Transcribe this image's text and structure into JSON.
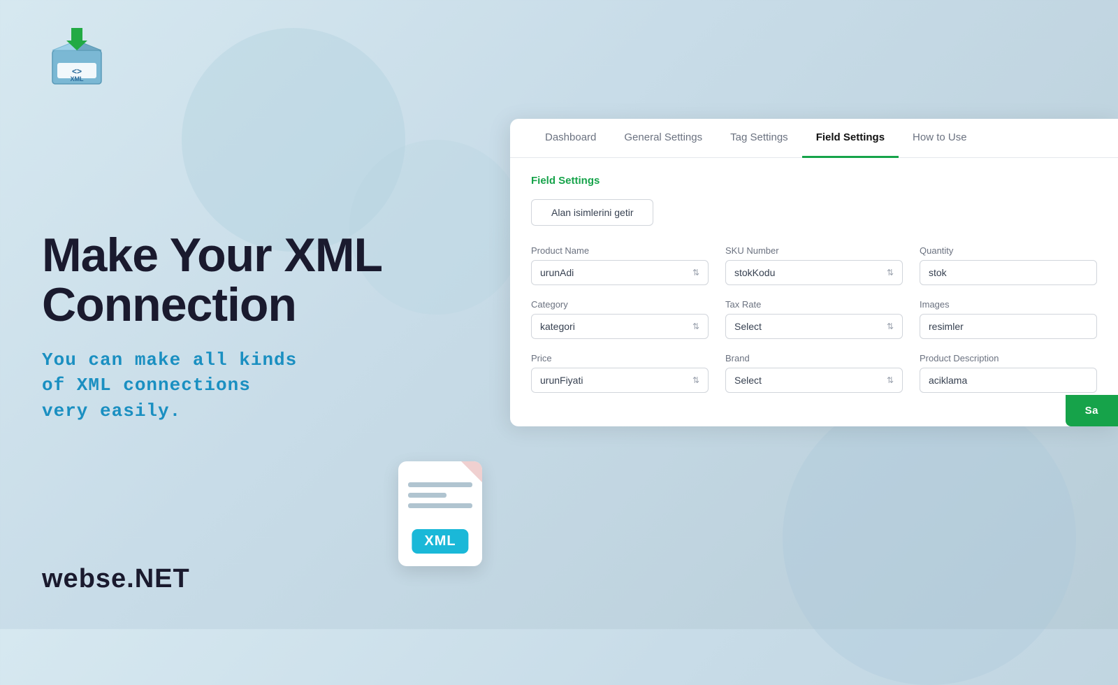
{
  "logo": {
    "alt": "XML Logo"
  },
  "hero": {
    "title": "Make Your XML Connection",
    "subtitle": "You can make all kinds\nof XML connections\nvery easily."
  },
  "brand": "webse.NET",
  "xml_file": {
    "label": "XML"
  },
  "nav": {
    "tabs": [
      {
        "id": "dashboard",
        "label": "Dashboard",
        "active": false
      },
      {
        "id": "general-settings",
        "label": "General Settings",
        "active": false
      },
      {
        "id": "tag-settings",
        "label": "Tag Settings",
        "active": false
      },
      {
        "id": "field-settings",
        "label": "Field Settings",
        "active": true
      },
      {
        "id": "how-to-use",
        "label": "How to Use",
        "active": false
      }
    ]
  },
  "field_settings": {
    "title": "Field Settings",
    "fetch_button": "Alan isimlerini getir",
    "fields": [
      {
        "id": "product-name",
        "label": "Product Name",
        "type": "select",
        "value": "urunAdi"
      },
      {
        "id": "sku-number",
        "label": "SKU Number",
        "type": "select",
        "value": "stokKodu"
      },
      {
        "id": "quantity",
        "label": "Quantity",
        "type": "input",
        "value": "stok"
      },
      {
        "id": "category",
        "label": "Category",
        "type": "select",
        "value": "kategori"
      },
      {
        "id": "tax-rate",
        "label": "Tax Rate",
        "type": "select",
        "value": "Select"
      },
      {
        "id": "images",
        "label": "Images",
        "type": "input",
        "value": "resimler"
      },
      {
        "id": "price",
        "label": "Price",
        "type": "select",
        "value": "urunFiyati"
      },
      {
        "id": "brand",
        "label": "Brand",
        "type": "select",
        "value": "Select"
      },
      {
        "id": "product-description",
        "label": "Product Description",
        "type": "input",
        "value": "aciklama"
      }
    ],
    "save_button": "Sa"
  }
}
